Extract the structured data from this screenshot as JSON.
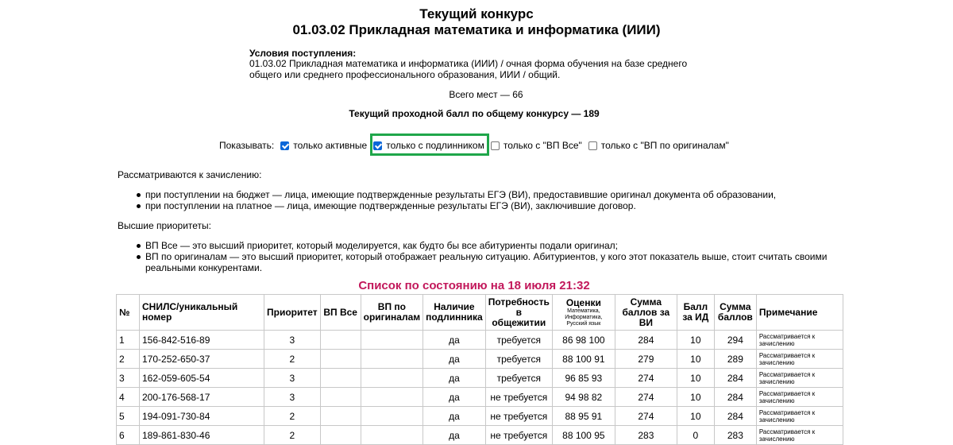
{
  "header": {
    "title": "Текущий конкурс",
    "program": "01.03.02 Прикладная математика и информатика (ИИИ)"
  },
  "conditions": {
    "heading": "Условия поступления:",
    "text": "01.03.02 Прикладная математика и информатика (ИИИ) / очная форма обучения на базе среднего общего или среднего профессионального образования, ИИИ / общий."
  },
  "places": "Всего мест — 66",
  "passing_score": "Текущий проходной балл по общему конкурсу — 189",
  "filters": {
    "label": "Показывать:",
    "options": [
      {
        "label": "только активные",
        "checked": true
      },
      {
        "label": "только с подлинником",
        "checked": true
      },
      {
        "label": "только с \"ВП Все\"",
        "checked": false
      },
      {
        "label": "только с \"ВП по оригиналам\"",
        "checked": false
      }
    ],
    "highlight_color": "#1fa64a"
  },
  "consider": {
    "heading": "Рассматриваются к зачислению:",
    "items": [
      "при поступлении на бюджет — лица, имеющие подтвержденные результаты ЕГЭ (ВИ), предоставившие оригинал документа об образовании,",
      "при поступлении на платное — лица, имеющие подтвержденные результаты ЕГЭ (ВИ), заключившие договор."
    ]
  },
  "priorities": {
    "heading": "Высшие приоритеты:",
    "items": [
      "ВП Все — это высший приоритет, который моделируется, как будто бы все абитуриенты подали оригинал;",
      "ВП по оригиналам — это высший приоритет, который отображает реальную ситуацию. Абитуриентов, у кого этот показатель выше, стоит считать своими реальными конкурентами."
    ]
  },
  "list_title": "Список по состоянию на 18 июля 21:32",
  "list_title_color": "#c2185b",
  "table": {
    "headers": {
      "num": "№",
      "snils": "СНИЛС/уникальный номер",
      "priority": "Приоритет",
      "vp_all": "ВП Все",
      "vp_orig": "ВП по оригиналам",
      "original": "Наличие подлинника",
      "dorm": "Потребность в общежитии",
      "grades": "Оценки",
      "grades_sub": "Математика, Информатика, Русский язык",
      "sum_vi": "Сумма баллов за ВИ",
      "id_score": "Балл за ИД",
      "total": "Сумма баллов",
      "note": "Примечание"
    },
    "rows": [
      {
        "num": "1",
        "snils": "156-842-516-89",
        "priority": "3",
        "vp_all": "",
        "vp_orig": "",
        "original": "да",
        "dorm": "требуется",
        "grades": "86 98 100",
        "sum_vi": "284",
        "id_score": "10",
        "total": "294",
        "note": "Рассматривается к зачислению"
      },
      {
        "num": "2",
        "snils": "170-252-650-37",
        "priority": "2",
        "vp_all": "",
        "vp_orig": "",
        "original": "да",
        "dorm": "требуется",
        "grades": "88 100 91",
        "sum_vi": "279",
        "id_score": "10",
        "total": "289",
        "note": "Рассматривается к зачислению"
      },
      {
        "num": "3",
        "snils": "162-059-605-54",
        "priority": "3",
        "vp_all": "",
        "vp_orig": "",
        "original": "да",
        "dorm": "требуется",
        "grades": "96 85 93",
        "sum_vi": "274",
        "id_score": "10",
        "total": "284",
        "note": "Рассматривается к зачислению"
      },
      {
        "num": "4",
        "snils": "200-176-568-17",
        "priority": "3",
        "vp_all": "",
        "vp_orig": "",
        "original": "да",
        "dorm": "не требуется",
        "grades": "94 98 82",
        "sum_vi": "274",
        "id_score": "10",
        "total": "284",
        "note": "Рассматривается к зачислению"
      },
      {
        "num": "5",
        "snils": "194-091-730-84",
        "priority": "2",
        "vp_all": "",
        "vp_orig": "",
        "original": "да",
        "dorm": "не требуется",
        "grades": "88 95 91",
        "sum_vi": "274",
        "id_score": "10",
        "total": "284",
        "note": "Рассматривается к зачислению"
      },
      {
        "num": "6",
        "snils": "189-861-830-46",
        "priority": "2",
        "vp_all": "",
        "vp_orig": "",
        "original": "да",
        "dorm": "не требуется",
        "grades": "88 100 95",
        "sum_vi": "283",
        "id_score": "0",
        "total": "283",
        "note": "Рассматривается к зачислению"
      }
    ]
  }
}
